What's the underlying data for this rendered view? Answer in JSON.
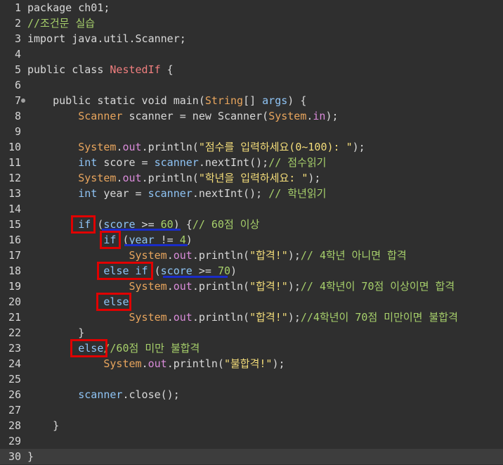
{
  "editor": {
    "lines": [
      {
        "n": "1",
        "tokens": [
          {
            "t": "package ch01;",
            "c": "plain"
          }
        ]
      },
      {
        "n": "2",
        "tokens": [
          {
            "t": "//조건문 실습",
            "c": "com"
          }
        ]
      },
      {
        "n": "3",
        "tokens": [
          {
            "t": "import java.util.Scanner;",
            "c": "plain"
          }
        ]
      },
      {
        "n": "4",
        "tokens": []
      },
      {
        "n": "5",
        "tokens": [
          {
            "t": "public class ",
            "c": "plain"
          },
          {
            "t": "NestedIf",
            "c": "cls2"
          },
          {
            "t": " {",
            "c": "plain"
          }
        ]
      },
      {
        "n": "6",
        "tokens": []
      },
      {
        "n": "7",
        "fold": true,
        "tokens": [
          {
            "t": "    public static void main(",
            "c": "plain"
          },
          {
            "t": "String",
            "c": "cls"
          },
          {
            "t": "[] ",
            "c": "plain"
          },
          {
            "t": "args",
            "c": "var"
          },
          {
            "t": ") {",
            "c": "plain"
          }
        ]
      },
      {
        "n": "8",
        "tokens": [
          {
            "t": "        ",
            "c": "plain"
          },
          {
            "t": "Scanner",
            "c": "cls"
          },
          {
            "t": " scanner = new ",
            "c": "plain"
          },
          {
            "t": "Scanner",
            "c": "plain"
          },
          {
            "t": "(",
            "c": "plain"
          },
          {
            "t": "System",
            "c": "cls"
          },
          {
            "t": ".",
            "c": "plain"
          },
          {
            "t": "in",
            "c": "fld"
          },
          {
            "t": ");",
            "c": "plain"
          }
        ]
      },
      {
        "n": "9",
        "tokens": []
      },
      {
        "n": "10",
        "tokens": [
          {
            "t": "        ",
            "c": "plain"
          },
          {
            "t": "System",
            "c": "cls"
          },
          {
            "t": ".",
            "c": "plain"
          },
          {
            "t": "out",
            "c": "fld"
          },
          {
            "t": ".println(",
            "c": "plain"
          },
          {
            "t": "\"점수를 입력하세요(0~100): \"",
            "c": "str"
          },
          {
            "t": ");",
            "c": "plain"
          }
        ]
      },
      {
        "n": "11",
        "tokens": [
          {
            "t": "        ",
            "c": "plain"
          },
          {
            "t": "int",
            "c": "kw"
          },
          {
            "t": " score = ",
            "c": "plain"
          },
          {
            "t": "scanner",
            "c": "var"
          },
          {
            "t": ".nextInt();",
            "c": "plain"
          },
          {
            "t": "// 점수읽기",
            "c": "com"
          }
        ]
      },
      {
        "n": "12",
        "tokens": [
          {
            "t": "        ",
            "c": "plain"
          },
          {
            "t": "System",
            "c": "cls"
          },
          {
            "t": ".",
            "c": "plain"
          },
          {
            "t": "out",
            "c": "fld"
          },
          {
            "t": ".println(",
            "c": "plain"
          },
          {
            "t": "\"학년을 입력하세요: \"",
            "c": "str"
          },
          {
            "t": ");",
            "c": "plain"
          }
        ]
      },
      {
        "n": "13",
        "tokens": [
          {
            "t": "        ",
            "c": "plain"
          },
          {
            "t": "int",
            "c": "kw"
          },
          {
            "t": " year = ",
            "c": "plain"
          },
          {
            "t": "scanner",
            "c": "var"
          },
          {
            "t": ".nextInt(); ",
            "c": "plain"
          },
          {
            "t": "// 학년읽기",
            "c": "com"
          }
        ]
      },
      {
        "n": "14",
        "tokens": []
      },
      {
        "n": "15",
        "tokens": [
          {
            "t": "        ",
            "c": "plain"
          },
          {
            "t": "if",
            "c": "kw"
          },
          {
            "t": " (",
            "c": "plain"
          },
          {
            "t": "score",
            "c": "var"
          },
          {
            "t": " >= ",
            "c": "plain"
          },
          {
            "t": "60",
            "c": "num"
          },
          {
            "t": ") {",
            "c": "plain"
          },
          {
            "t": "// 60점 이상",
            "c": "com"
          }
        ]
      },
      {
        "n": "16",
        "tokens": [
          {
            "t": "            ",
            "c": "plain"
          },
          {
            "t": "if",
            "c": "kw"
          },
          {
            "t": " (",
            "c": "plain"
          },
          {
            "t": "year",
            "c": "var"
          },
          {
            "t": " != ",
            "c": "plain"
          },
          {
            "t": "4",
            "c": "num"
          },
          {
            "t": ")",
            "c": "plain"
          }
        ]
      },
      {
        "n": "17",
        "tokens": [
          {
            "t": "                ",
            "c": "plain"
          },
          {
            "t": "System",
            "c": "cls"
          },
          {
            "t": ".",
            "c": "plain"
          },
          {
            "t": "out",
            "c": "fld"
          },
          {
            "t": ".println(",
            "c": "plain"
          },
          {
            "t": "\"합격!\"",
            "c": "str"
          },
          {
            "t": ");",
            "c": "plain"
          },
          {
            "t": "// 4학년 아니면 합격",
            "c": "com"
          }
        ]
      },
      {
        "n": "18",
        "tokens": [
          {
            "t": "            ",
            "c": "plain"
          },
          {
            "t": "else if",
            "c": "kw"
          },
          {
            "t": " (",
            "c": "plain"
          },
          {
            "t": "score",
            "c": "var"
          },
          {
            "t": " >= ",
            "c": "plain"
          },
          {
            "t": "70",
            "c": "num"
          },
          {
            "t": ")",
            "c": "plain"
          }
        ]
      },
      {
        "n": "19",
        "tokens": [
          {
            "t": "                ",
            "c": "plain"
          },
          {
            "t": "System",
            "c": "cls"
          },
          {
            "t": ".",
            "c": "plain"
          },
          {
            "t": "out",
            "c": "fld"
          },
          {
            "t": ".println(",
            "c": "plain"
          },
          {
            "t": "\"합격!\"",
            "c": "str"
          },
          {
            "t": ");",
            "c": "plain"
          },
          {
            "t": "// 4학년이 70점 이상이면 합격",
            "c": "com"
          }
        ]
      },
      {
        "n": "20",
        "tokens": [
          {
            "t": "            ",
            "c": "plain"
          },
          {
            "t": "else",
            "c": "kw"
          }
        ]
      },
      {
        "n": "21",
        "tokens": [
          {
            "t": "                ",
            "c": "plain"
          },
          {
            "t": "System",
            "c": "cls"
          },
          {
            "t": ".",
            "c": "plain"
          },
          {
            "t": "out",
            "c": "fld"
          },
          {
            "t": ".println(",
            "c": "plain"
          },
          {
            "t": "\"합격!\"",
            "c": "str"
          },
          {
            "t": ");",
            "c": "plain"
          },
          {
            "t": "//4학년이 70점 미만이면 불합격",
            "c": "com"
          }
        ]
      },
      {
        "n": "22",
        "tokens": [
          {
            "t": "        }",
            "c": "plain"
          }
        ]
      },
      {
        "n": "23",
        "tokens": [
          {
            "t": "        ",
            "c": "plain"
          },
          {
            "t": "else",
            "c": "kw"
          },
          {
            "t": "//60점 미만 불합격",
            "c": "com"
          }
        ]
      },
      {
        "n": "24",
        "tokens": [
          {
            "t": "            ",
            "c": "plain"
          },
          {
            "t": "System",
            "c": "cls"
          },
          {
            "t": ".",
            "c": "plain"
          },
          {
            "t": "out",
            "c": "fld"
          },
          {
            "t": ".println(",
            "c": "plain"
          },
          {
            "t": "\"불합격!\"",
            "c": "str"
          },
          {
            "t": ");",
            "c": "plain"
          }
        ]
      },
      {
        "n": "25",
        "tokens": []
      },
      {
        "n": "26",
        "tokens": [
          {
            "t": "        ",
            "c": "plain"
          },
          {
            "t": "scanner",
            "c": "var"
          },
          {
            "t": ".close();",
            "c": "plain"
          }
        ]
      },
      {
        "n": "27",
        "tokens": []
      },
      {
        "n": "28",
        "tokens": [
          {
            "t": "    }",
            "c": "plain"
          }
        ]
      },
      {
        "n": "29",
        "tokens": []
      },
      {
        "n": "30",
        "current": true,
        "tokens": [
          {
            "t": "}",
            "c": "plain"
          }
        ]
      }
    ]
  },
  "annotations": {
    "box_color": "#e00000",
    "underline_color": "#1a2cc8"
  }
}
